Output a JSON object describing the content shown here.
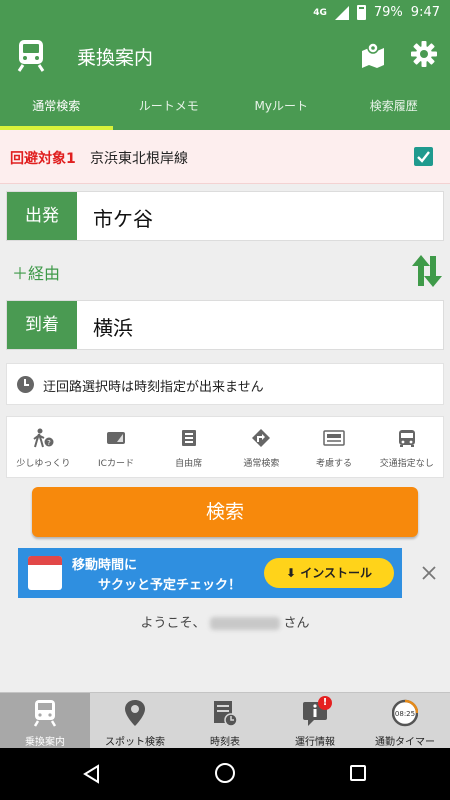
{
  "status_bar": {
    "network": "4G",
    "battery": "79%",
    "time": "9:47"
  },
  "app_bar": {
    "title": "乗換案内"
  },
  "tabs": [
    {
      "label": "通常検索",
      "active": true
    },
    {
      "label": "ルートメモ"
    },
    {
      "label": "Myルート"
    },
    {
      "label": "検索履歴"
    }
  ],
  "avoid": {
    "label": "回避対象1",
    "line": "京浜東北根岸線",
    "checked": true
  },
  "departure": {
    "tag": "出発",
    "station": "市ケ谷"
  },
  "via": {
    "label": "＋経由"
  },
  "arrival": {
    "tag": "到着",
    "station": "横浜"
  },
  "note": {
    "text": "迂回路選択時は時刻指定が出来ません"
  },
  "options": [
    {
      "label": "少しゆっくり",
      "icon": "walking-person-icon"
    },
    {
      "label": "ICカード",
      "icon": "ic-card-icon"
    },
    {
      "label": "自由席",
      "icon": "free-seat-icon"
    },
    {
      "label": "通常検索",
      "icon": "route-sign-icon"
    },
    {
      "label": "考慮する",
      "icon": "commuter-pass-icon"
    },
    {
      "label": "交通指定なし",
      "icon": "bus-icon"
    }
  ],
  "search_button": {
    "label": "検索"
  },
  "ad": {
    "line1": "移動時間に",
    "line2": "サクッと予定チェック！",
    "install_label": "インストール"
  },
  "welcome": {
    "prefix": "ようこそ、",
    "suffix": "さん"
  },
  "bottom_nav": [
    {
      "label": "乗換案内",
      "icon": "train-icon",
      "active": true
    },
    {
      "label": "スポット検索",
      "icon": "map-pin-icon"
    },
    {
      "label": "時刻表",
      "icon": "timetable-icon"
    },
    {
      "label": "運行情報",
      "icon": "info-icon",
      "badge": "!"
    },
    {
      "label": "通勤タイマー",
      "icon": "timer-icon",
      "timer_text": "08:25"
    }
  ],
  "colors": {
    "primary": "#4a9a52",
    "accent_tab": "#d9f23a",
    "search": "#f7890c",
    "avoid_label": "#e02020"
  }
}
